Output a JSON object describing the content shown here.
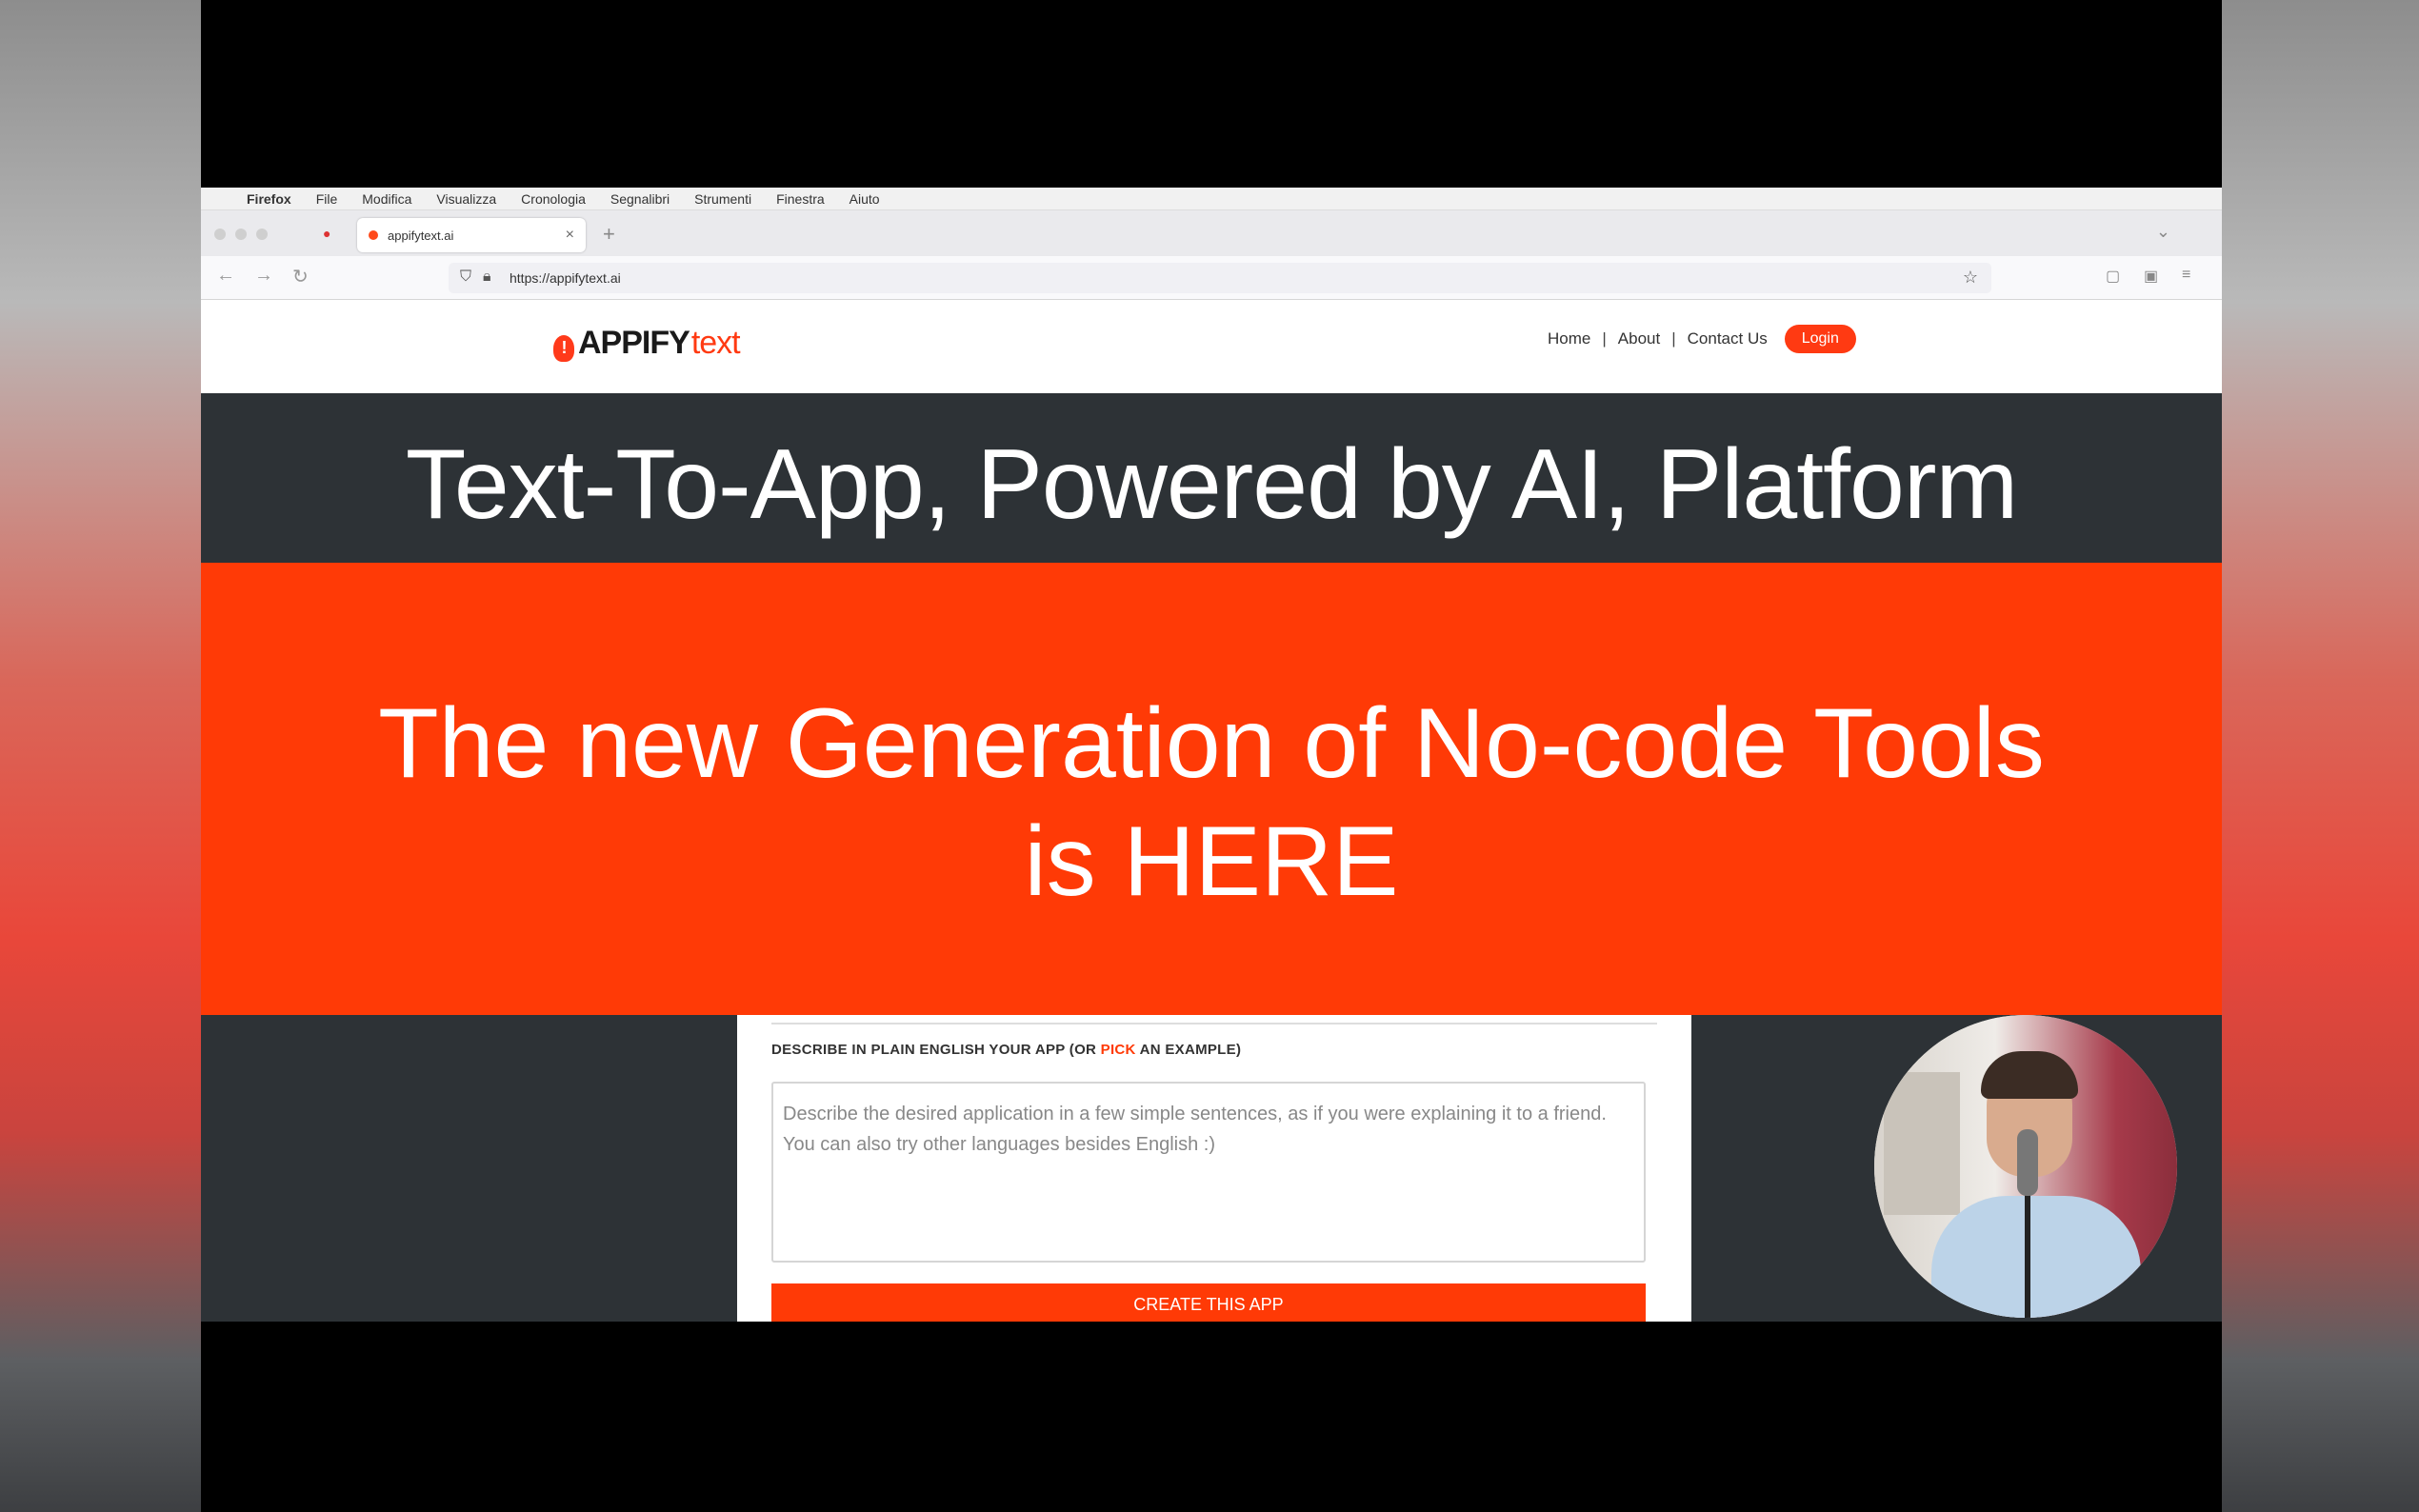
{
  "menubar": {
    "apple": "",
    "items": [
      "Firefox",
      "File",
      "Modifica",
      "Visualizza",
      "Cronologia",
      "Segnalibri",
      "Strumenti",
      "Finestra",
      "Aiuto"
    ]
  },
  "browser": {
    "tab_title": "appifytext.ai",
    "tab_close": "×",
    "new_tab": "+",
    "url": "https://appifytext.ai"
  },
  "site": {
    "logo_main": "APPIFY",
    "logo_text": "text",
    "nav": [
      "Home",
      "About",
      "Contact Us"
    ],
    "separator": "|",
    "login": "Login"
  },
  "hero": {
    "title": "Text-To-App, Powered by AI, Platform",
    "subtitle_line1": "The new Generation of No-code Tools",
    "subtitle_line2": "is HERE"
  },
  "form": {
    "label_before": "DESCRIBE IN PLAIN ENGLISH YOUR APP (OR ",
    "label_pick": "PICK",
    "label_after": " AN EXAMPLE)",
    "placeholder": "Describe the desired application in a few simple sentences, as if you were explaining it to a friend. You can also try other languages besides English :)",
    "button": "CREATE THIS APP"
  },
  "colors": {
    "accent": "#ff3a06",
    "dark": "#2d3236"
  }
}
